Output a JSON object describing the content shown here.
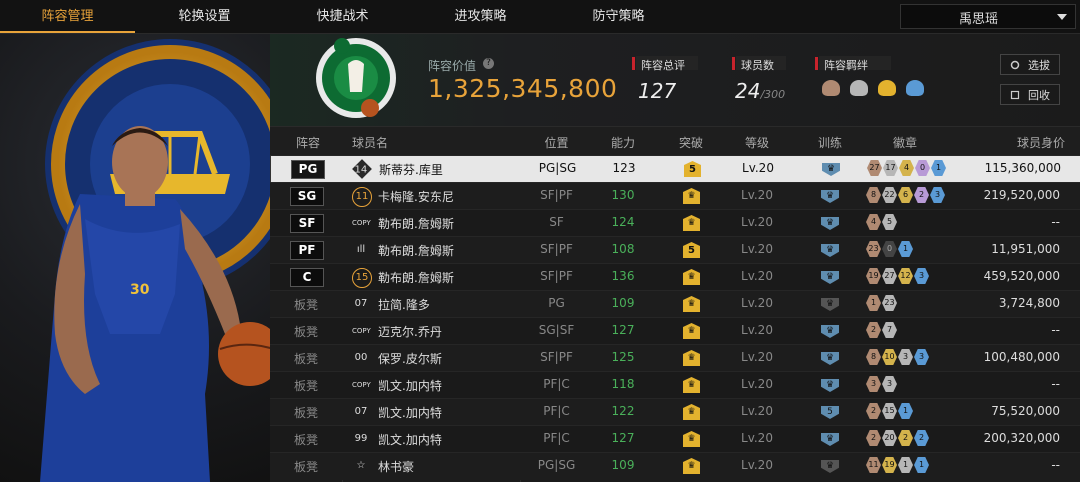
{
  "nav": {
    "tabs": [
      "阵容管理",
      "轮换设置",
      "快捷战术",
      "进攻策略",
      "防守策略"
    ],
    "active_index": 0,
    "user_select": "禹思瑶"
  },
  "summary": {
    "value_label": "阵容价值",
    "value": "1,325,345,800",
    "rating_label": "阵容总评",
    "rating": "127",
    "count_label": "球员数",
    "count": "24",
    "count_max": "/300",
    "bond_label": "阵容羁绊",
    "select_button": "选拔",
    "recycle_button": "回收",
    "logo_text": "BOSTON CELTICS"
  },
  "colors": {
    "accent": "#e8a33a",
    "ability_green": "#4ab05a",
    "red_mark": "#c8232c",
    "train_blue": "#5f8db0"
  },
  "table": {
    "headers": [
      "阵容",
      "球员名",
      "位置",
      "能力",
      "突破",
      "等级",
      "训练",
      "徽章",
      "球员身价"
    ],
    "rows": [
      {
        "slot": "PG",
        "bench": false,
        "num": "14",
        "num_style": "dia",
        "name": "斯蒂芬.库里",
        "pos": "PG|SG",
        "ability": "123",
        "break": "5",
        "level": "Lv.20",
        "train": "blue",
        "train_num": "",
        "badges": [
          [
            "b",
            "27"
          ],
          [
            "s",
            "17"
          ],
          [
            "g",
            "4"
          ],
          [
            "p",
            "0"
          ],
          [
            "d",
            "1"
          ]
        ],
        "value": "115,360,000",
        "selected": true
      },
      {
        "slot": "SG",
        "bench": false,
        "num": "11",
        "num_style": "tb",
        "name": "卡梅隆.安东尼",
        "pos": "SF|PF",
        "ability": "130",
        "break": "",
        "level": "Lv.20",
        "train": "blue",
        "train_num": "",
        "badges": [
          [
            "b",
            "8"
          ],
          [
            "s",
            "22"
          ],
          [
            "g",
            "6"
          ],
          [
            "p",
            "2"
          ],
          [
            "d",
            "3"
          ]
        ],
        "value": "219,520,000",
        "selected": false
      },
      {
        "slot": "SF",
        "bench": false,
        "num": "COPY",
        "num_style": "text",
        "name": "勒布朗.詹姆斯",
        "pos": "SF",
        "ability": "124",
        "break": "",
        "level": "Lv.20",
        "train": "blue",
        "train_num": "",
        "badges": [
          [
            "b",
            "4"
          ],
          [
            "s",
            "5"
          ]
        ],
        "value": "--",
        "selected": false
      },
      {
        "slot": "PF",
        "bench": false,
        "num": "ıll",
        "num_style": "text",
        "name": "勒布朗.詹姆斯",
        "pos": "SF|PF",
        "ability": "108",
        "break": "5",
        "level": "Lv.20",
        "train": "blue",
        "train_num": "",
        "badges": [
          [
            "b",
            "23"
          ],
          [
            "z",
            "0"
          ],
          [
            "d",
            "1"
          ]
        ],
        "value": "11,951,000",
        "selected": false
      },
      {
        "slot": "C",
        "bench": false,
        "num": "15",
        "num_style": "tb",
        "name": "勒布朗.詹姆斯",
        "pos": "SF|PF",
        "ability": "136",
        "break": "",
        "level": "Lv.20",
        "train": "blue",
        "train_num": "",
        "badges": [
          [
            "b",
            "19"
          ],
          [
            "s",
            "27"
          ],
          [
            "g",
            "12"
          ],
          [
            "d",
            "3"
          ]
        ],
        "value": "459,520,000",
        "selected": false
      },
      {
        "slot": "板凳",
        "bench": true,
        "num": "07",
        "num_style": "text",
        "name": "拉简.隆多",
        "pos": "PG",
        "ability": "109",
        "break": "",
        "level": "Lv.20",
        "train": "gray",
        "train_num": "",
        "badges": [
          [
            "b",
            "1"
          ],
          [
            "s",
            "23"
          ]
        ],
        "value": "3,724,800",
        "selected": false
      },
      {
        "slot": "板凳",
        "bench": true,
        "num": "COPY",
        "num_style": "text",
        "name": "迈克尔.乔丹",
        "pos": "SG|SF",
        "ability": "127",
        "break": "",
        "level": "Lv.20",
        "train": "blue",
        "train_num": "",
        "badges": [
          [
            "b",
            "2"
          ],
          [
            "s",
            "7"
          ]
        ],
        "value": "--",
        "selected": false
      },
      {
        "slot": "板凳",
        "bench": true,
        "num": "00",
        "num_style": "text",
        "name": "保罗.皮尔斯",
        "pos": "SF|PF",
        "ability": "125",
        "break": "",
        "level": "Lv.20",
        "train": "blue",
        "train_num": "",
        "badges": [
          [
            "b",
            "8"
          ],
          [
            "g",
            "10"
          ],
          [
            "s",
            "3"
          ],
          [
            "d",
            "3"
          ]
        ],
        "value": "100,480,000",
        "selected": false
      },
      {
        "slot": "板凳",
        "bench": true,
        "num": "COPY",
        "num_style": "text",
        "name": "凯文.加内特",
        "pos": "PF|C",
        "ability": "118",
        "break": "",
        "level": "Lv.20",
        "train": "blue",
        "train_num": "",
        "badges": [
          [
            "b",
            "3"
          ],
          [
            "s",
            "3"
          ]
        ],
        "value": "--",
        "selected": false
      },
      {
        "slot": "板凳",
        "bench": true,
        "num": "07",
        "num_style": "text",
        "name": "凯文.加内特",
        "pos": "PF|C",
        "ability": "122",
        "break": "",
        "level": "Lv.20",
        "train": "blue",
        "train_num": "5",
        "badges": [
          [
            "b",
            "2"
          ],
          [
            "s",
            "15"
          ],
          [
            "d",
            "1"
          ]
        ],
        "value": "75,520,000",
        "selected": false
      },
      {
        "slot": "板凳",
        "bench": true,
        "num": "99",
        "num_style": "text",
        "name": "凯文.加内特",
        "pos": "PF|C",
        "ability": "127",
        "break": "",
        "level": "Lv.20",
        "train": "blue",
        "train_num": "",
        "badges": [
          [
            "b",
            "2"
          ],
          [
            "s",
            "20"
          ],
          [
            "g",
            "2"
          ],
          [
            "d",
            "2"
          ]
        ],
        "value": "200,320,000",
        "selected": false
      },
      {
        "slot": "板凳",
        "bench": true,
        "num": "☆",
        "num_style": "text",
        "name": "林书豪",
        "pos": "PG|SG",
        "ability": "109",
        "break": "",
        "level": "Lv.20",
        "train": "gray",
        "train_num": "",
        "badges": [
          [
            "b",
            "11"
          ],
          [
            "g",
            "19"
          ],
          [
            "s",
            "1"
          ],
          [
            "d",
            "1"
          ]
        ],
        "value": "--",
        "selected": false
      }
    ]
  }
}
